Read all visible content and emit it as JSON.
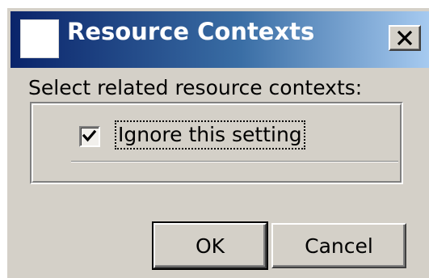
{
  "window": {
    "title": "Resource Contexts",
    "close_icon": "close-x-icon",
    "app_icon": "blank-document-icon"
  },
  "dialog": {
    "prompt": "Select related resource contexts:",
    "checkbox": {
      "label": "Ignore this setting",
      "checked": true
    }
  },
  "buttons": {
    "ok": "OK",
    "cancel": "Cancel"
  },
  "colors": {
    "titlebar_start": "#0a246a",
    "titlebar_end": "#a6caf0",
    "dialog_face": "#d4d0c8"
  }
}
